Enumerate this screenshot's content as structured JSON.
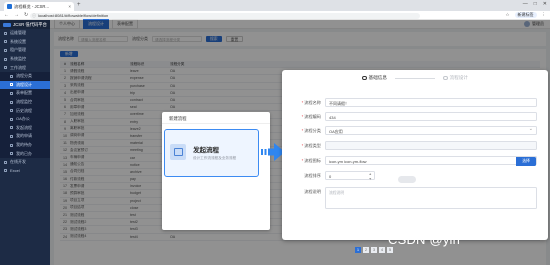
{
  "browser": {
    "tab_title": "流程概览 - JCSR...",
    "url": "localhost:8081/#/flowable/flow/definition",
    "sync_label": "新建标签",
    "win_controls": [
      "—",
      "□",
      "✕"
    ]
  },
  "app": {
    "logo": "JCSR 低代码平台",
    "sidebar": [
      {
        "label": "运维管理",
        "sub": false,
        "active": false
      },
      {
        "label": "系统设置",
        "sub": false,
        "active": false
      },
      {
        "label": "租户管理",
        "sub": false,
        "active": false
      },
      {
        "label": "系统监控",
        "sub": false,
        "active": false
      },
      {
        "label": "工作流程",
        "sub": false,
        "active": false
      },
      {
        "label": "流程分类",
        "sub": true,
        "active": false
      },
      {
        "label": "流程设计",
        "sub": true,
        "active": true
      },
      {
        "label": "表单配置",
        "sub": true,
        "active": false
      },
      {
        "label": "流程监控",
        "sub": true,
        "active": false
      },
      {
        "label": "历史流程",
        "sub": true,
        "active": false
      },
      {
        "label": "OA办公",
        "sub": true,
        "active": false
      },
      {
        "label": "发起流程",
        "sub": true,
        "active": false
      },
      {
        "label": "我的申请",
        "sub": true,
        "active": false
      },
      {
        "label": "我的待办",
        "sub": true,
        "active": false
      },
      {
        "label": "我的已办",
        "sub": true,
        "active": false
      },
      {
        "label": "在线开发",
        "sub": false,
        "active": false
      },
      {
        "label": "Excel",
        "sub": false,
        "active": false
      }
    ],
    "top_tabs": [
      {
        "label": "个人中心",
        "on": false
      },
      {
        "label": "流程设计",
        "on": true
      },
      {
        "label": "表单配置",
        "on": false
      }
    ],
    "user": "管理员",
    "filter": {
      "name_label": "流程名称",
      "name_placeholder": "请输入流程名称",
      "cat_label": "流程分类",
      "cat_placeholder": "请选择流程分类",
      "search_btn": "搜索",
      "reset_btn": "重置"
    },
    "add_btn": "新增",
    "table_header": [
      "#",
      "流程名称",
      "流程标识",
      "流程分类"
    ],
    "table_rows": [
      [
        "1",
        "请假流程",
        "leave",
        "OA"
      ],
      [
        "2",
        "报销申请流程",
        "expense",
        "OA"
      ],
      [
        "3",
        "采购流程",
        "purchase",
        "OA"
      ],
      [
        "4",
        "出差申请",
        "trip",
        "OA"
      ],
      [
        "5",
        "合同审批",
        "contract",
        "OA"
      ],
      [
        "6",
        "用章申请",
        "seal",
        "OA"
      ],
      [
        "7",
        "加班流程",
        "overtime",
        "OA"
      ],
      [
        "8",
        "入职审批",
        "entry",
        "HR"
      ],
      [
        "9",
        "离职审批",
        "leave2",
        "HR"
      ],
      [
        "10",
        "调岗申请",
        "transfer",
        "HR"
      ],
      [
        "11",
        "物资领用",
        "material",
        "OA"
      ],
      [
        "12",
        "会议室预订",
        "meeting",
        "OA"
      ],
      [
        "13",
        "车辆申请",
        "car",
        "OA"
      ],
      [
        "14",
        "通知公告",
        "notice",
        "OA"
      ],
      [
        "15",
        "合同归档",
        "archive",
        "OA"
      ],
      [
        "16",
        "付款流程",
        "pay",
        "FIN"
      ],
      [
        "17",
        "发票申请",
        "invoice",
        "FIN"
      ],
      [
        "18",
        "预算审批",
        "budget",
        "FIN"
      ],
      [
        "19",
        "项目立项",
        "project",
        "PM"
      ],
      [
        "20",
        "项目结项",
        "close",
        "PM"
      ],
      [
        "21",
        "测试流程",
        "test",
        "OA"
      ],
      [
        "22",
        "测试流程2",
        "test2",
        "OA"
      ],
      [
        "23",
        "测试流程3",
        "test3",
        "OA"
      ],
      [
        "24",
        "测试流程4",
        "test4",
        "OA"
      ]
    ],
    "pager": [
      "1",
      "2",
      "3",
      "4",
      "5"
    ]
  },
  "new_flow_dialog": {
    "title": "新建流程",
    "choice_title": "发起流程",
    "choice_subtitle": "设计工作流流程及业务流程"
  },
  "form_dialog": {
    "steps": [
      "基础信息",
      "流程设计"
    ],
    "fields": [
      {
        "label": "流程名称",
        "required": true,
        "value": "不同请假！",
        "kind": "input"
      },
      {
        "label": "流程编码",
        "required": true,
        "value": "434",
        "kind": "input"
      },
      {
        "label": "流程分类",
        "required": true,
        "value": "OA应用",
        "kind": "select"
      },
      {
        "label": "流程类型",
        "required": true,
        "value": "",
        "kind": "disabled"
      },
      {
        "label": "流程图标",
        "required": true,
        "value": "icon-ym icon-ym-flow",
        "kind": "icon",
        "button": "选择"
      },
      {
        "label": "流程排序",
        "required": false,
        "value": "0",
        "kind": "stepper"
      },
      {
        "label": "流程说明",
        "required": false,
        "value": "",
        "placeholder": "流程说明",
        "kind": "textarea"
      }
    ]
  },
  "watermark": "CSDN @yin",
  "colors": {
    "primary": "#2b6fd6",
    "sidebar": "#1d2b45",
    "highlight": "#3d8bf2"
  }
}
